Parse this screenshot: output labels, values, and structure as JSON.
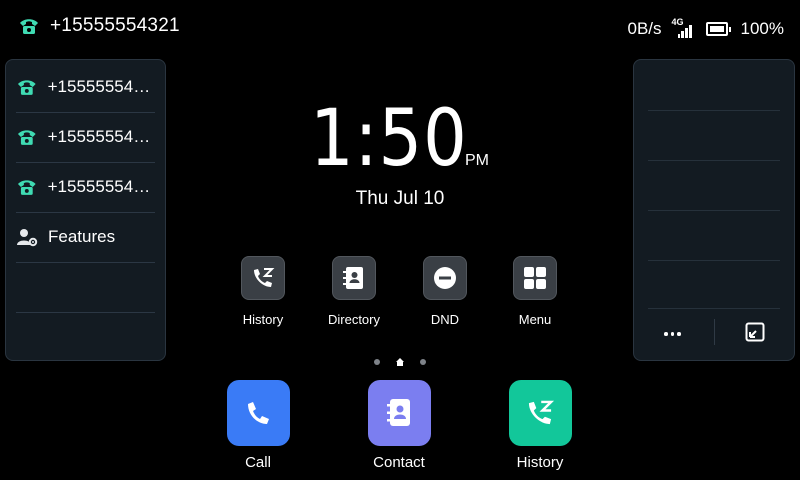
{
  "status": {
    "account": "+15555554321",
    "speed": "0B/s",
    "network": "4G",
    "battery": "100%"
  },
  "left_panel": {
    "lines": [
      {
        "label": "+155555543...",
        "icon": "phone-line-icon"
      },
      {
        "label": "+155555543...",
        "icon": "phone-line-icon"
      },
      {
        "label": "+155555543...",
        "icon": "phone-line-icon"
      },
      {
        "label": "Features",
        "icon": "user-settings-icon"
      }
    ]
  },
  "clock": {
    "time": "1:50",
    "ampm": "PM",
    "date": "Thu Jul 10"
  },
  "quick_apps": [
    {
      "label": "History",
      "icon": "call-history-icon"
    },
    {
      "label": "Directory",
      "icon": "directory-icon"
    },
    {
      "label": "DND",
      "icon": "dnd-icon"
    },
    {
      "label": "Menu",
      "icon": "menu-grid-icon"
    }
  ],
  "dock": [
    {
      "label": "Call",
      "icon": "phone-icon",
      "color": "#3a7bf6"
    },
    {
      "label": "Contact",
      "icon": "contact-icon",
      "color": "#7b7ef0"
    },
    {
      "label": "History",
      "icon": "call-history-icon",
      "color": "#12c79a"
    }
  ],
  "colors": {
    "accent_green": "#3fdbb3",
    "panel_bg": "#131b22"
  },
  "right_panel": {
    "more_icon": "more-dots-icon",
    "expand_icon": "expand-icon"
  }
}
